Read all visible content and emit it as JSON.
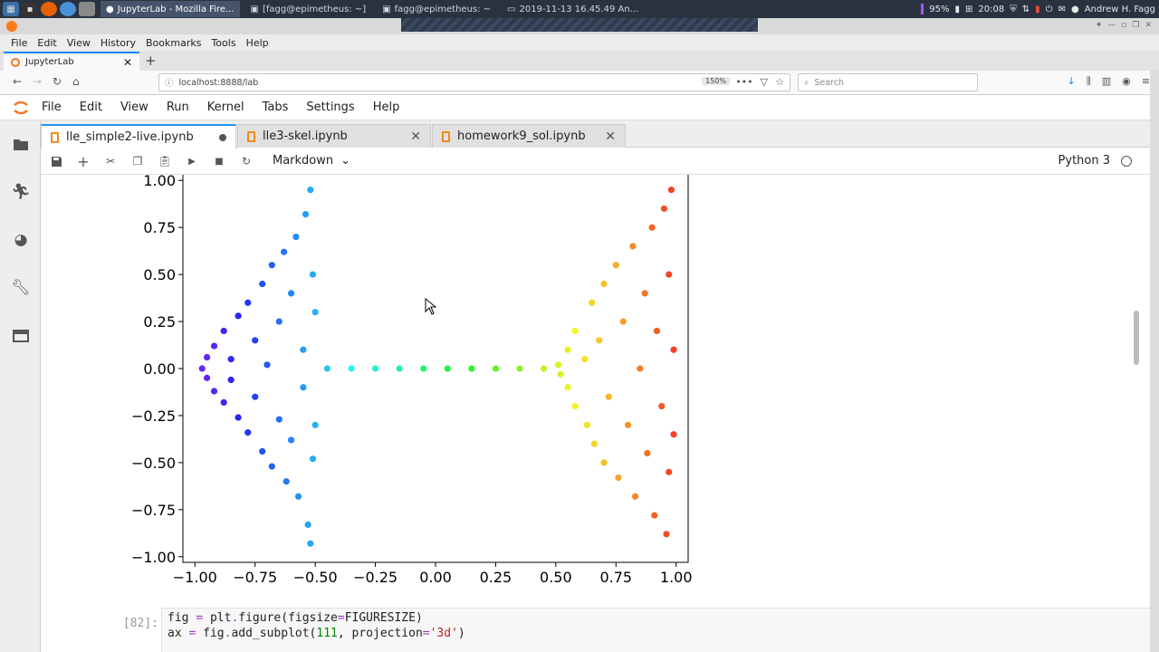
{
  "taskbar": {
    "tasks": [
      {
        "label": "JupyterLab - Mozilla Fire...",
        "active": true
      },
      {
        "label": "[fagg@epimetheus: ~]",
        "active": false
      },
      {
        "label": "fagg@epimetheus: ~",
        "active": false
      },
      {
        "label": "2019-11-13 16.45.49 An...",
        "active": false
      }
    ],
    "battery": "95%",
    "clock": "20:08",
    "user": "Andrew H. Fagg"
  },
  "firefox": {
    "menu": [
      "File",
      "Edit",
      "View",
      "History",
      "Bookmarks",
      "Tools",
      "Help"
    ],
    "tab_title": "JupyterLab",
    "url": "localhost:8888/lab",
    "zoom": "150%",
    "search_placeholder": "Search"
  },
  "jupyter": {
    "menu": [
      "File",
      "Edit",
      "View",
      "Run",
      "Kernel",
      "Tabs",
      "Settings",
      "Help"
    ],
    "tabs": [
      {
        "label": "lle_simple2-live.ipynb",
        "active": true,
        "modified": true
      },
      {
        "label": "lle3-skel.ipynb",
        "active": false,
        "modified": false
      },
      {
        "label": "homework9_sol.ipynb",
        "active": false,
        "modified": false
      }
    ],
    "cell_type": "Markdown",
    "kernel": "Python 3"
  },
  "chart_data": {
    "type": "scatter",
    "title": "",
    "xlabel": "",
    "ylabel": "",
    "xlim": [
      -1.05,
      1.05
    ],
    "ylim": [
      -1.03,
      1.03
    ],
    "xticks": [
      "−1.00",
      "−0.75",
      "−0.50",
      "−0.25",
      "0.00",
      "0.25",
      "0.50",
      "0.75",
      "1.00"
    ],
    "yticks": [
      "1.00",
      "0.75",
      "0.50",
      "0.25",
      "0.00",
      "−0.25",
      "−0.50",
      "−0.75",
      "−1.00"
    ],
    "colormap": "rainbow (purple to red by x)",
    "series": [
      {
        "values": [
          [
            -0.97,
            0.0
          ],
          [
            -0.95,
            0.06
          ],
          [
            -0.95,
            -0.05
          ],
          [
            -0.92,
            0.12
          ],
          [
            -0.92,
            -0.12
          ],
          [
            -0.88,
            0.2
          ],
          [
            -0.88,
            -0.18
          ],
          [
            -0.85,
            0.05
          ],
          [
            -0.85,
            -0.06
          ],
          [
            -0.82,
            0.28
          ],
          [
            -0.82,
            -0.26
          ],
          [
            -0.78,
            0.35
          ],
          [
            -0.78,
            -0.34
          ],
          [
            -0.75,
            0.15
          ],
          [
            -0.75,
            -0.15
          ],
          [
            -0.72,
            0.45
          ],
          [
            -0.72,
            -0.44
          ],
          [
            -0.7,
            0.02
          ],
          [
            -0.68,
            0.55
          ],
          [
            -0.68,
            -0.52
          ],
          [
            -0.65,
            0.25
          ],
          [
            -0.65,
            -0.27
          ],
          [
            -0.63,
            0.62
          ],
          [
            -0.62,
            -0.6
          ],
          [
            -0.6,
            0.4
          ],
          [
            -0.6,
            -0.38
          ],
          [
            -0.58,
            0.7
          ],
          [
            -0.57,
            -0.68
          ],
          [
            -0.55,
            0.1
          ],
          [
            -0.55,
            -0.1
          ],
          [
            -0.54,
            0.82
          ],
          [
            -0.53,
            -0.83
          ],
          [
            -0.52,
            0.95
          ],
          [
            -0.52,
            -0.93
          ],
          [
            -0.51,
            0.5
          ],
          [
            -0.51,
            -0.48
          ],
          [
            -0.5,
            0.3
          ],
          [
            -0.5,
            -0.3
          ],
          [
            -0.45,
            0.0
          ],
          [
            -0.35,
            0.0
          ],
          [
            -0.25,
            0.0
          ],
          [
            -0.15,
            0.0
          ],
          [
            -0.05,
            0.0
          ],
          [
            0.05,
            0.0
          ],
          [
            0.15,
            0.0
          ],
          [
            0.25,
            0.0
          ],
          [
            0.35,
            0.0
          ],
          [
            0.45,
            0.0
          ],
          [
            0.51,
            0.02
          ],
          [
            0.52,
            -0.03
          ],
          [
            0.55,
            0.1
          ],
          [
            0.55,
            -0.1
          ],
          [
            0.58,
            0.2
          ],
          [
            0.58,
            -0.2
          ],
          [
            0.62,
            0.05
          ],
          [
            0.63,
            -0.3
          ],
          [
            0.65,
            0.35
          ],
          [
            0.66,
            -0.4
          ],
          [
            0.68,
            0.15
          ],
          [
            0.7,
            0.45
          ],
          [
            0.7,
            -0.5
          ],
          [
            0.72,
            -0.15
          ],
          [
            0.75,
            0.55
          ],
          [
            0.76,
            -0.58
          ],
          [
            0.78,
            0.25
          ],
          [
            0.8,
            -0.3
          ],
          [
            0.82,
            0.65
          ],
          [
            0.83,
            -0.68
          ],
          [
            0.85,
            0.0
          ],
          [
            0.87,
            0.4
          ],
          [
            0.88,
            -0.45
          ],
          [
            0.9,
            0.75
          ],
          [
            0.91,
            -0.78
          ],
          [
            0.92,
            0.2
          ],
          [
            0.94,
            -0.2
          ],
          [
            0.95,
            0.85
          ],
          [
            0.96,
            -0.88
          ],
          [
            0.97,
            0.5
          ],
          [
            0.97,
            -0.55
          ],
          [
            0.98,
            0.95
          ],
          [
            0.99,
            0.1
          ],
          [
            0.99,
            -0.35
          ]
        ]
      }
    ]
  }
}
